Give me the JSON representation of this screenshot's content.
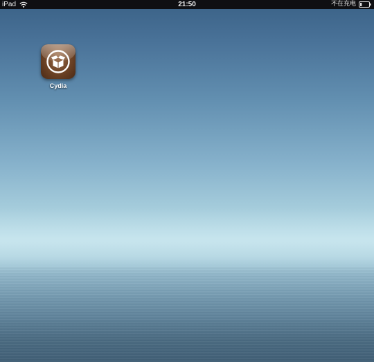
{
  "status_bar": {
    "carrier": "iPad",
    "wifi_icon": "wifi-icon",
    "time": "21:50",
    "charging_status": "不在充电",
    "battery_icon": "battery-icon",
    "battery_level": 0.2
  },
  "home_screen": {
    "apps": [
      {
        "label": "Cydia",
        "icon": "cydia-box-icon"
      }
    ]
  },
  "colors": {
    "status_bar_bg": "#0f0f12",
    "sky_top": "#3a6186",
    "horizon": "#bcdfe9",
    "water_bottom": "#4b6c84",
    "cydia_brown": "#6d4326"
  }
}
